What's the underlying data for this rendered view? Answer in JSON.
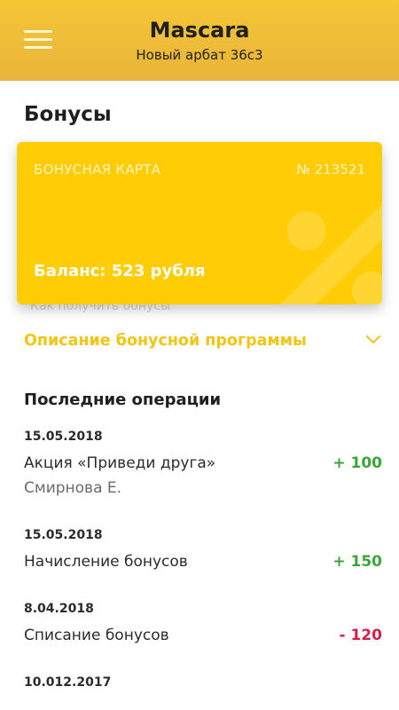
{
  "header": {
    "title": "Mascara",
    "subtitle": "Новый арбат 36с3",
    "menu_icon": "hamburger-menu-icon"
  },
  "page": {
    "title": "Бонусы"
  },
  "card": {
    "label": "БОНУСНАЯ КАРТА",
    "number": "№ 213521",
    "balance": "Баланс: 523 рубля",
    "partially_hidden_text": "Как получить бонусы",
    "color": "#ffcc05"
  },
  "program": {
    "label": "Описание бонусной программы",
    "icon": "chevron-down-icon",
    "color": "#f2c413"
  },
  "operations": {
    "title": "Последние операции",
    "items": [
      {
        "date": "15.05.2018",
        "title": "Акция «Приведи друга»",
        "subtitle": "Смирнова Е.",
        "amount": "+ 100"
      },
      {
        "date": "15.05.2018",
        "title": "Начисление бонусов",
        "subtitle": "",
        "amount": "+ 150"
      },
      {
        "date": "8.04.2018",
        "title": "Списание бонусов",
        "subtitle": "",
        "amount": "- 120"
      },
      {
        "date": "10.012.2017",
        "title": "",
        "subtitle": "",
        "amount": ""
      }
    ]
  },
  "colors": {
    "header_gradient_top": "#f6c635",
    "header_gradient_bottom": "#e8b43a",
    "positive": "#3aa63a",
    "negative": "#d1204b"
  }
}
